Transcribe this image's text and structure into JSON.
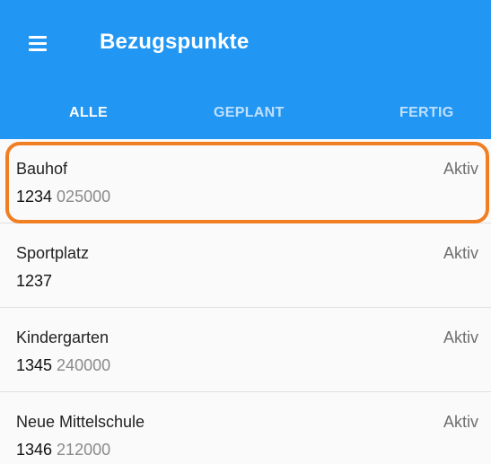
{
  "appbar": {
    "title": "Bezugspunkte",
    "menu_icon": "menu-icon",
    "color": "#2196f3"
  },
  "tabs": [
    {
      "label": "ALLE",
      "active": true
    },
    {
      "label": "GEPLANT",
      "active": false
    },
    {
      "label": "FERTIG",
      "active": false
    }
  ],
  "items": [
    {
      "name": "Bauhof",
      "status": "Aktiv",
      "code": "1234",
      "subcode": "025000",
      "highlighted": true
    },
    {
      "name": "Sportplatz",
      "status": "Aktiv",
      "code": "1237",
      "subcode": "",
      "highlighted": false
    },
    {
      "name": "Kindergarten",
      "status": "Aktiv",
      "code": "1345",
      "subcode": "240000",
      "highlighted": false
    },
    {
      "name": "Neue Mittelschule",
      "status": "Aktiv",
      "code": "1346",
      "subcode": "212000",
      "highlighted": false
    }
  ],
  "highlight_color": "#f07f24"
}
